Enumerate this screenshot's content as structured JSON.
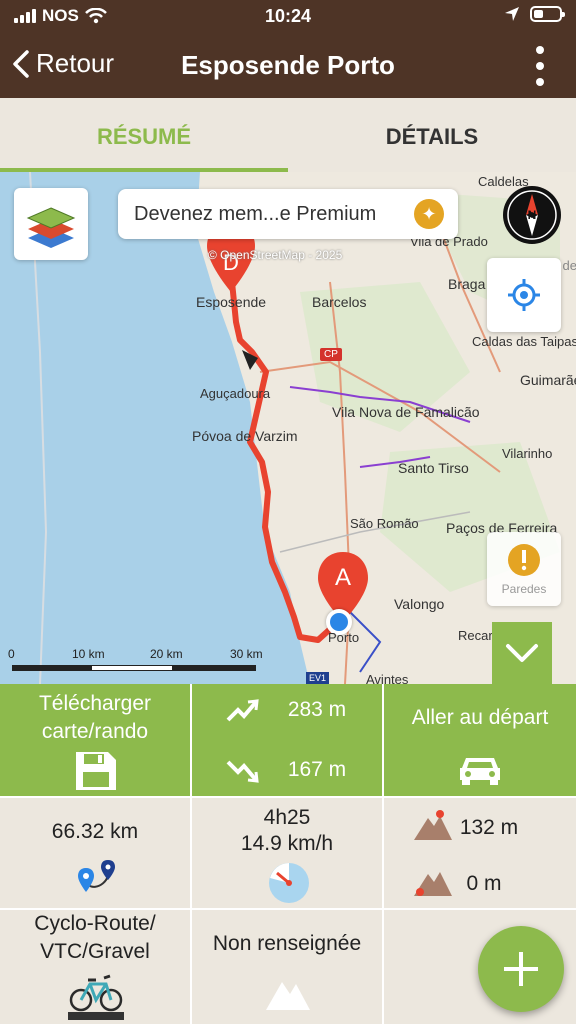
{
  "status": {
    "carrier": "NOS",
    "time": "10:24"
  },
  "nav": {
    "back_label": "Retour",
    "title": "Esposende Porto"
  },
  "tabs": [
    {
      "label": "RÉSUMÉ"
    },
    {
      "label": "DÉTAILS"
    }
  ],
  "map": {
    "premium_text": "Devenez mem...e Premium",
    "attribution": "© OpenStreetMap - 2025",
    "compass_letter": "N",
    "warning_label": "Paredes",
    "markers": {
      "start": "A",
      "end": "D"
    },
    "scale_labels": [
      "0",
      "10 km",
      "20 km",
      "30 km"
    ],
    "places": {
      "caldelas": "Caldelas",
      "vila_de_prado": "Vila de Prado",
      "povoa_de_lanhoso": "Póvoa de",
      "esposende": "Esposende",
      "barcelos": "Barcelos",
      "braga": "Braga",
      "caldas_das_taipas": "Caldas das Taipas",
      "guimaraes": "Guimarães",
      "cp": "CP",
      "agucadoura": "Aguçadoura",
      "vila_nova_de_famalicao": "Vila Nova de Famalicão",
      "povoa_de_varzim": "Póvoa de Varzim",
      "vilarinho": "Vilarinho",
      "santo_tirso": "Santo Tirso",
      "sao_romao": "São Romão",
      "pacos_de_ferreira": "Paços de Ferreira",
      "valongo": "Valongo",
      "porto": "Porto",
      "recarei": "Recarei",
      "avintes": "Avintes",
      "ev1": "EV1"
    }
  },
  "stats": {
    "download_label": "Télécharger carte/rando",
    "ascent": "283 m",
    "descent": "167 m",
    "go_to_start_label": "Aller au départ",
    "distance": "66.32 km",
    "duration": "4h25",
    "speed": "14.9 km/h",
    "max_altitude": "132 m",
    "min_altitude": "0 m",
    "activity": "Cyclo-Route/ VTC/Gravel",
    "difficulty": "Non renseignée"
  },
  "colors": {
    "brand_brown": "#4e3426",
    "accent_green": "#8dba4c",
    "route_red": "#e8432f",
    "sea_blue": "#a9d0e8"
  }
}
